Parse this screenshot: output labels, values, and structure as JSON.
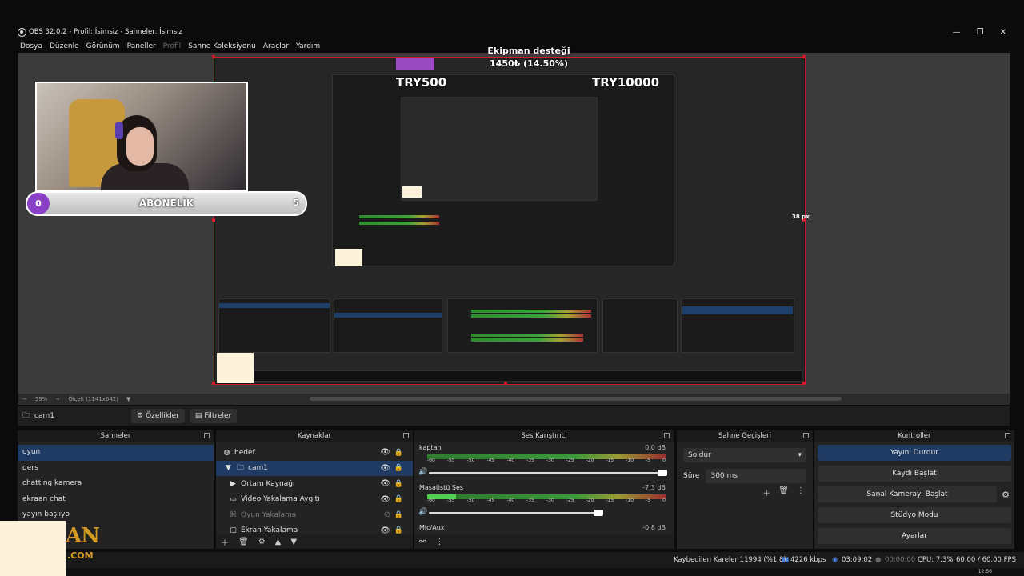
{
  "window": {
    "title": "OBS 32.0.2 - Profil: İsimsiz - Sahneler: İsimsiz",
    "minimize": "—",
    "maximize": "❐",
    "close": "✕"
  },
  "menu": {
    "items": [
      "Dosya",
      "Düzenle",
      "Görünüm",
      "Paneller",
      "Profil",
      "Sahne Koleksiyonu",
      "Araçlar",
      "Yardım"
    ]
  },
  "preview": {
    "donation_title": "Ekipman desteği",
    "donation_amount": "1450₺ (14.50%)",
    "goal_left": "TRY500",
    "goal_right": "TRY10000",
    "sub_bar_left": "0",
    "sub_bar_label": "ABONELİK",
    "sub_bar_right": "5",
    "px_label": "38 px",
    "zoom_percent": "59%",
    "canvas_size": "Ölçek (1141x642)"
  },
  "source_toolbar": {
    "source_name": "cam1",
    "properties_label": "Özellikler",
    "filters_label": "Filtreler"
  },
  "scenes": {
    "header": "Sahneler",
    "items": [
      "oyun",
      "ders",
      "chatting kamera",
      "ekraan chat",
      "yayın başlıyo"
    ]
  },
  "sources": {
    "header": "Kaynaklar",
    "items": [
      {
        "label": "hedef",
        "icon": "globe-icon"
      },
      {
        "label": "cam1",
        "icon": "folder-icon"
      },
      {
        "label": "Ortam Kaynağı",
        "icon": "play-icon"
      },
      {
        "label": "Video Yakalama Aygıtı",
        "icon": "camera-icon"
      },
      {
        "label": "Oyun Yakalama",
        "icon": "gamepad-icon"
      },
      {
        "label": "Ekran Yakalama",
        "icon": "monitor-icon"
      }
    ]
  },
  "mixer": {
    "header": "Ses Karıştırıcı",
    "channels": [
      {
        "name": "kaptan",
        "db": "0.0 dB"
      },
      {
        "name": "Masaüstü Ses",
        "db": "-7.3 dB"
      },
      {
        "name": "Mic/Aux",
        "db": "-0.8 dB"
      }
    ],
    "scale": [
      "-60",
      "-55",
      "-50",
      "-45",
      "-40",
      "-35",
      "-30",
      "-25",
      "-20",
      "-15",
      "-10",
      "-5",
      "0"
    ]
  },
  "transitions": {
    "header": "Sahne Geçişleri",
    "selected": "Soldur",
    "duration_label": "Süre",
    "duration_value": "300 ms"
  },
  "controls": {
    "header": "Kontroller",
    "buttons": [
      "Yayını Durdur",
      "Kaydı Başlat",
      "Sanal Kamerayı Başlat",
      "Stüdyo Modu",
      "Ayarlar"
    ]
  },
  "status": {
    "dropped": "Kaybedilen Kareler 11994 (%1.8)",
    "bitrate": "4226 kbps",
    "stream_time": "03:09:02",
    "rec_time": "00:00:00",
    "cpu": "CPU: 7.3%",
    "fps": "60.00 / 60.00 FPS"
  },
  "overlay": {
    "logo_text": "AN",
    "logo_sub": ".COM"
  },
  "taskbar": {
    "time": "12:56"
  }
}
